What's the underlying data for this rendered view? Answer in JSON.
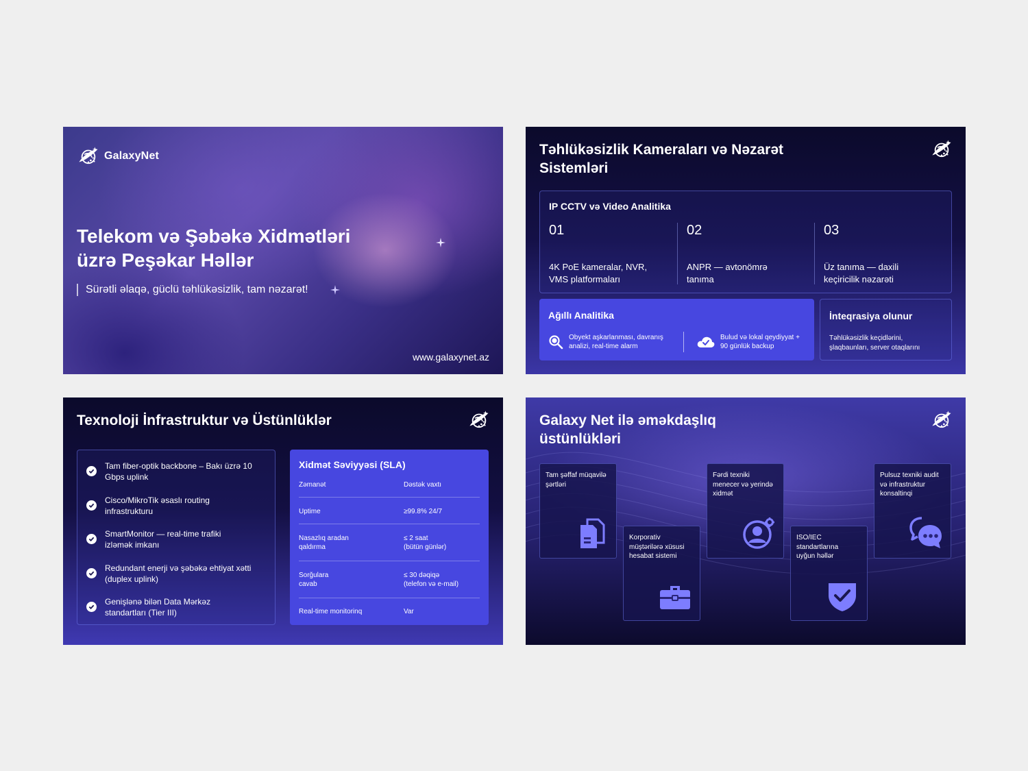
{
  "colors": {
    "page_bg": "#efefef",
    "accent": "#4747e0",
    "icon_accent": "#7d7dff",
    "dark": "#0b0a2b"
  },
  "slide1": {
    "brand": "GalaxyNet",
    "title_line1": "Telekom və Şəbəkə Xidmətləri",
    "title_line2": "üzrə Peşəkar Həllər",
    "subtitle": "Sürətli əlaqə, güclü təhlükəsizlik, tam nəzarət!",
    "url": "www.galaxynet.az"
  },
  "slide2": {
    "title_line1": "Təhlükəsizlik Kameraları və Nəzarət",
    "title_line2": "Sistemləri",
    "cctv_heading": "IP CCTV və Video Analitika",
    "steps": [
      {
        "num": "01",
        "line1": "4K PoE kameralar, NVR,",
        "line2": "VMS platformaları"
      },
      {
        "num": "02",
        "line1": "ANPR — avtonömrə",
        "line2": "tanıma"
      },
      {
        "num": "03",
        "line1": "Üz tanıma — daxili",
        "line2": "keçiricilik nəzarəti"
      }
    ],
    "analytics_title": "Ağıllı Analitika",
    "analytics_items": [
      {
        "icon": "search-icon",
        "line1": "Obyekt aşkarlanması, davranış",
        "line2": "analizi, real-time alarm"
      },
      {
        "icon": "cloud-check-icon",
        "line1": "Bulud və lokal qeydiyyat +",
        "line2": "90 günlük backup"
      }
    ],
    "integration_title": "İnteqrasiya olunur",
    "integration_line1": "Təhlükəsizlik keçidlərini,",
    "integration_line2": "şlaqbaunları, server otaqlarını"
  },
  "slide3": {
    "title": "Texnoloji İnfrastruktur və Üstünlüklər",
    "features": [
      {
        "line1": "Tam fiber-optik backbone – Bakı üzrə 10",
        "line2": "Gbps uplink"
      },
      {
        "line1": "Cisco/MikroTik əsaslı routing",
        "line2": "infrastrukturu"
      },
      {
        "line1": "SmartMonitor — real-time trafiki",
        "line2": "izləmək imkanı"
      },
      {
        "line1": "Redundant enerji və şəbəkə ehtiyat xətti",
        "line2": "(duplex uplink)"
      },
      {
        "line1": "Genişlənə bilən Data Mərkəz",
        "line2": "standartları (Tier III)"
      }
    ],
    "sla_title": "Xidmət Səviyyəsi (SLA)",
    "sla_header": {
      "c1": "Zəmanət",
      "c2": "Dəstək vaxtı"
    },
    "sla_rows": [
      {
        "c1a": "Uptime",
        "c1b": "",
        "c2a": "≥99.8% 24/7",
        "c2b": ""
      },
      {
        "c1a": "Nasazlıq aradan",
        "c1b": "qaldırma",
        "c2a": "≤ 2 saat",
        "c2b": "(bütün günlər)"
      },
      {
        "c1a": "Sorğulara",
        "c1b": "cavab",
        "c2a": "≤ 30 dəqiqə",
        "c2b": "(telefon və e-mail)"
      },
      {
        "c1a": "Real-time monitorinq",
        "c1b": "",
        "c2a": "Var",
        "c2b": ""
      }
    ]
  },
  "slide4": {
    "title_line1": "Galaxy Net ilə əməkdaşlıq",
    "title_line2": "üstünlükləri",
    "cards": [
      {
        "icon": "document-icon",
        "l1": "Tam şəffaf müqavilə",
        "l2": "şərtləri",
        "l3": ""
      },
      {
        "icon": "briefcase-icon",
        "l1": "Korporativ",
        "l2": "müştərilərə xüsusi",
        "l3": "hesabat sistemi"
      },
      {
        "icon": "user-settings-icon",
        "l1": "Fərdi texniki",
        "l2": "menecer və yerində",
        "l3": "xidmət"
      },
      {
        "icon": "shield-check-icon",
        "l1": "ISO/IEC",
        "l2": "standartlarına",
        "l3": "uyğun həllər"
      },
      {
        "icon": "chat-icon",
        "l1": "Pulsuz texniki audit",
        "l2": "və infrastruktur",
        "l3": "konsaltinqi"
      }
    ]
  }
}
